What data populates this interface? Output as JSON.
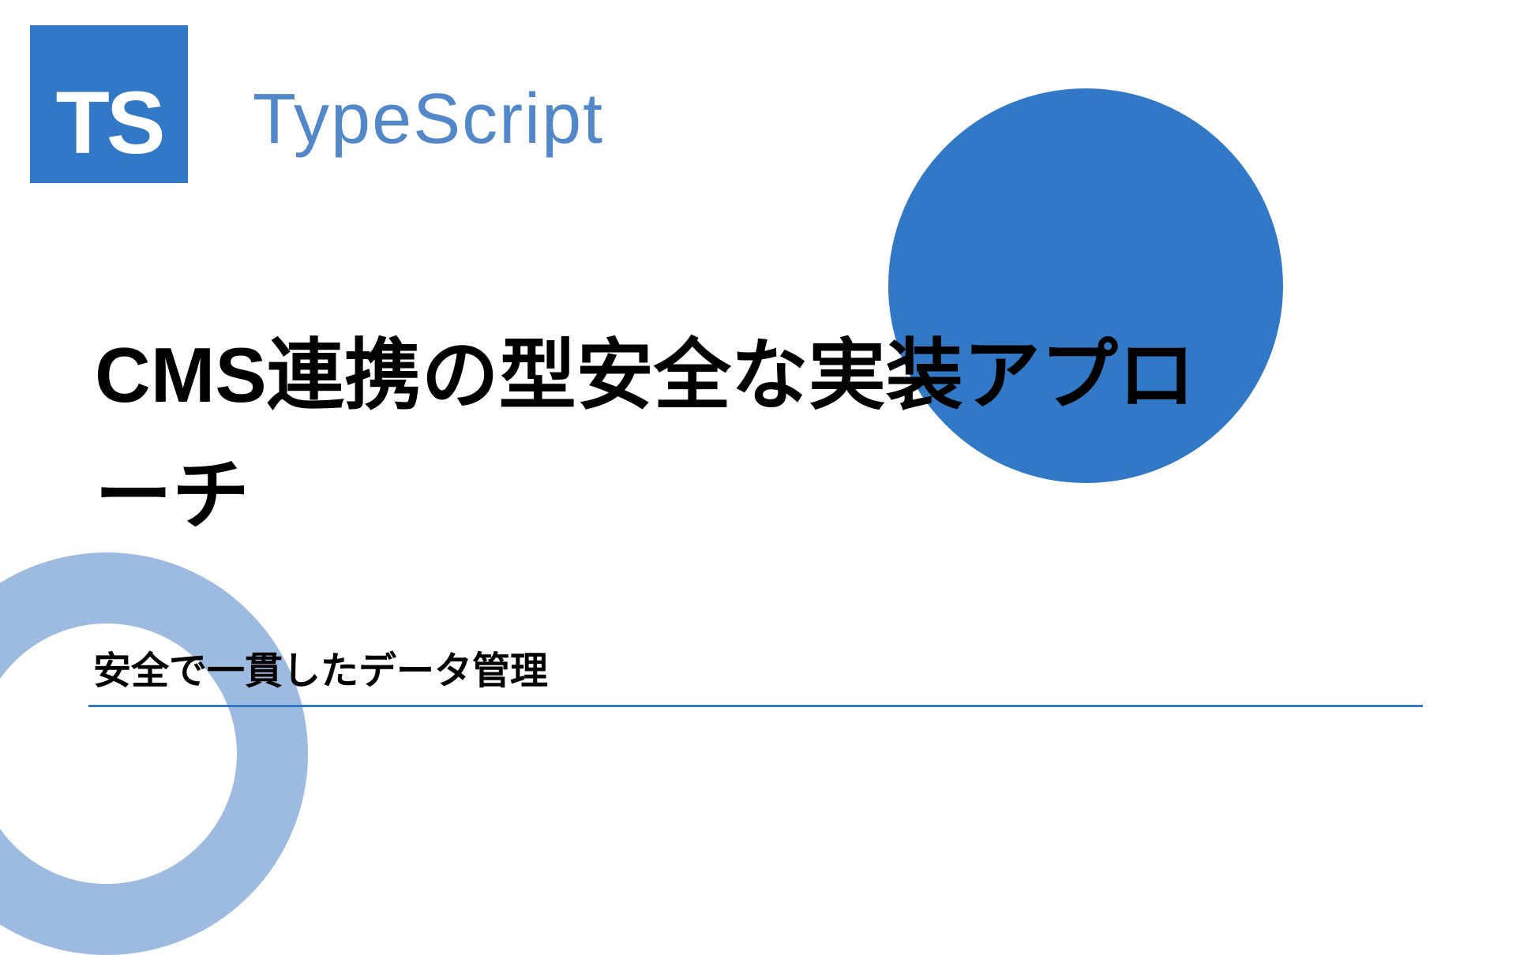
{
  "logo": {
    "text": "TS"
  },
  "brand": "TypeScript",
  "title": "CMS連携の型安全な実装アプローチ",
  "subtitle": "安全で一貫したデータ管理",
  "colors": {
    "primary": "#3178c6",
    "accent": "#8caedc"
  }
}
